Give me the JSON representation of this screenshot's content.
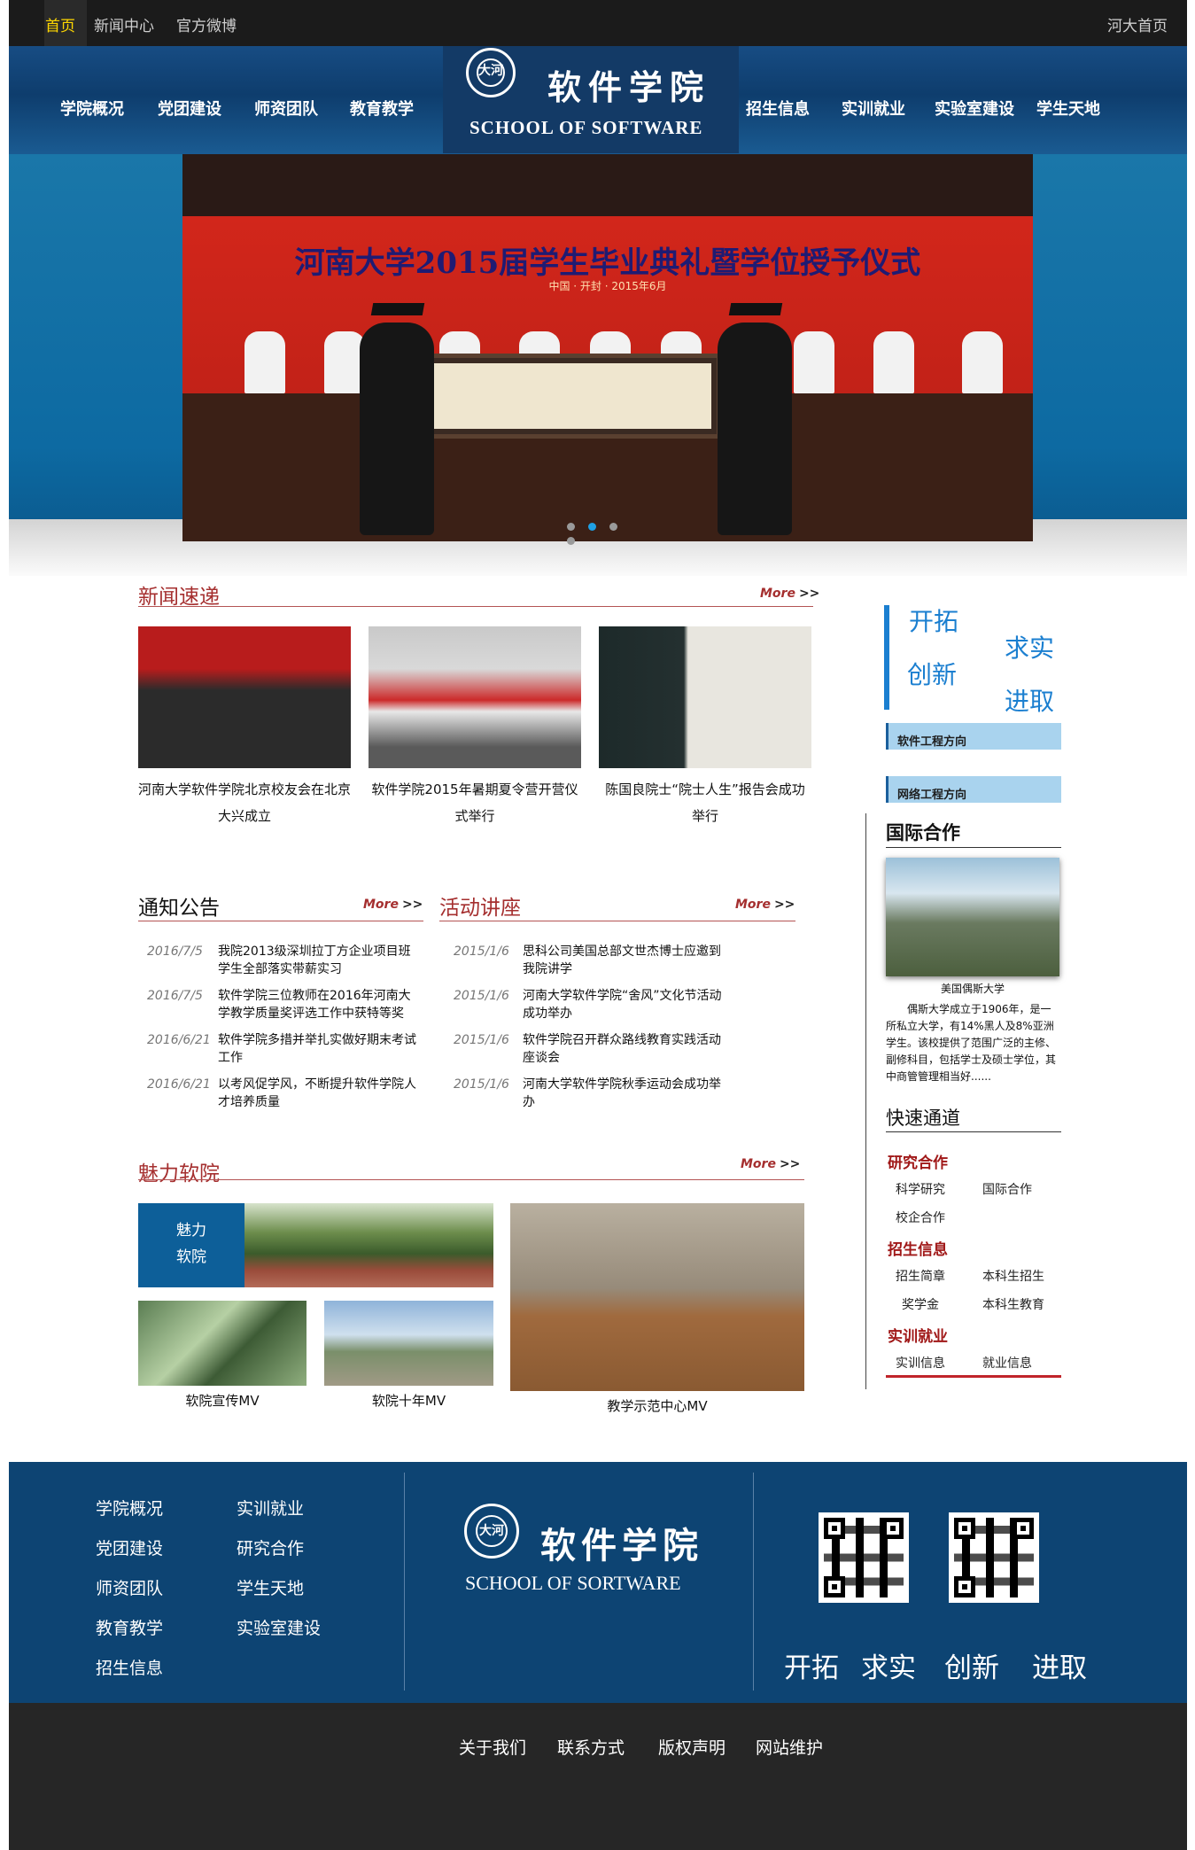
{
  "topbar": {
    "home": "首页",
    "news_center": "新闻中心",
    "weibo": "官方微博",
    "henu_home": "河大首页"
  },
  "nav": {
    "left": [
      "学院概况",
      "党团建设",
      "师资团队",
      "教育教学"
    ],
    "right": [
      "招生信息",
      "实训就业",
      "实验室建设",
      "学生天地"
    ],
    "logo_seal": "大河",
    "logo_cn": "软件学院",
    "logo_en": "SCHOOL OF SOFTWARE"
  },
  "hero": {
    "banner_title": "河南大学2015届学生毕业典礼暨学位授予仪式",
    "banner_sub": "中国 · 开封 · 2015年6月",
    "slides": 4,
    "active_slide": 2
  },
  "news": {
    "title": "新闻速递",
    "more": "More",
    "more_arrow": ">>",
    "items": [
      {
        "caption": "河南大学软件学院北京校友会在北京大兴成立"
      },
      {
        "caption": "软件学院2015年暑期夏令营开营仪式举行"
      },
      {
        "caption": "陈国良院士“院士人生”报告会成功举行"
      }
    ]
  },
  "notices": {
    "title": "通知公告",
    "more": "More",
    "more_arrow": ">>",
    "items": [
      {
        "date": "2016/7/5",
        "text": "我院2013级深圳拉丁方企业项目班学生全部落实带薪实习"
      },
      {
        "date": "2016/7/5",
        "text": "软件学院三位教师在2016年河南大学教学质量奖评选工作中获特等奖"
      },
      {
        "date": "2016/6/21",
        "text": "软件学院多措并举扎实做好期末考试工作"
      },
      {
        "date": "2016/6/21",
        "text": "以考风促学风，不断提升软件学院人才培养质量"
      }
    ]
  },
  "lectures": {
    "title": "活动讲座",
    "more": "More",
    "more_arrow": ">>",
    "items": [
      {
        "date": "2015/1/6",
        "text": "思科公司美国总部文世杰博士应邀到我院讲学"
      },
      {
        "date": "2015/1/6",
        "text": "河南大学软件学院“舍风”文化节活动成功举办"
      },
      {
        "date": "2015/1/6",
        "text": "软件学院召开群众路线教育实践活动座谈会"
      },
      {
        "date": "2015/1/6",
        "text": "河南大学软件学院秋季运动会成功举办"
      }
    ]
  },
  "charm": {
    "title": "魅力软院",
    "more": "More",
    "more_arrow": ">>",
    "tile_label_1": "魅力",
    "tile_label_2": "软院",
    "videos": [
      "软院宣传MV",
      "软院十年MV",
      "教学示范中心MV"
    ]
  },
  "sidebar": {
    "motto": [
      "开拓",
      "求实",
      "创新",
      "进取"
    ],
    "directions": [
      "软件工程方向",
      "网络工程方向"
    ],
    "intl_title": "国际合作",
    "intl_caption": "美国偶斯大学",
    "intl_desc": "偶斯大学成立于1906年，是一所私立大学，有14%黑人及8%亚洲学生。该校提供了范围广泛的主修、副修科目，包括学士及硕士学位，其中商管管理相当好......",
    "quick_title": "快速通道",
    "groups": [
      {
        "title": "研究合作",
        "items": [
          "科学研究",
          "国际合作",
          "校企合作"
        ]
      },
      {
        "title": "招生信息",
        "items": [
          "招生简章",
          "本科生招生",
          "奖学金",
          "本科生教育"
        ]
      },
      {
        "title": "实训就业",
        "items": [
          "实训信息",
          "就业信息"
        ]
      }
    ]
  },
  "footer": {
    "links_col1": [
      "学院概况",
      "党团建设",
      "师资团队",
      "教育教学",
      "招生信息"
    ],
    "links_col2": [
      "实训就业",
      "研究合作",
      "学生天地",
      "实验室建设"
    ],
    "logo_seal": "大河",
    "logo_cn": "软件学院",
    "logo_en": "SCHOOL OF SORTWARE",
    "motto": [
      "开拓",
      "求实",
      "创新",
      "进取"
    ],
    "bottom_links": [
      "关于我们",
      "联系方式",
      "版权声明",
      "网站维护"
    ]
  },
  "colors": {
    "nav_blue": "#0e3d6d",
    "hero_blue": "#0d6aa2",
    "accent_red": "#a52f2f",
    "motto_blue": "#1b7fd0",
    "footer_blue": "#0d4473",
    "bottom_dark": "#262626"
  }
}
